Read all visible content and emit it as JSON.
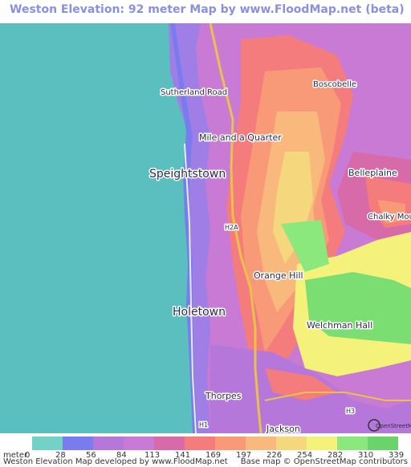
{
  "header": {
    "title": "Weston Elevation: 92 meter Map by www.FloodMap.net (beta)"
  },
  "map": {
    "places": [
      "Boscobelle",
      "Sutherland Road",
      "Mile and a Quarter",
      "Speightstown",
      "Belleplaine",
      "Chalky Mount",
      "H2A",
      "Orange Hill",
      "Holetown",
      "Welchman Hall",
      "Thorpes",
      "H3",
      "Jackson",
      "H1",
      "OpenStreetMap"
    ]
  },
  "legend": {
    "unit_label": "meter",
    "ticks": [
      "0",
      "28",
      "56",
      "84",
      "113",
      "141",
      "169",
      "197",
      "226",
      "254",
      "282",
      "310",
      "339"
    ],
    "colors": [
      "#73d2c8",
      "#7b7bf0",
      "#b677db",
      "#c97ad6",
      "#d76aa8",
      "#f47c7c",
      "#f89a78",
      "#f9b97c",
      "#f5d77e",
      "#f4f27a",
      "#8be87d",
      "#6ad46a"
    ]
  },
  "footer": {
    "left_text": "Weston Elevation Map developed by www.FloodMap.net",
    "right_text": "Base map © OpenStreetMap contributors"
  }
}
